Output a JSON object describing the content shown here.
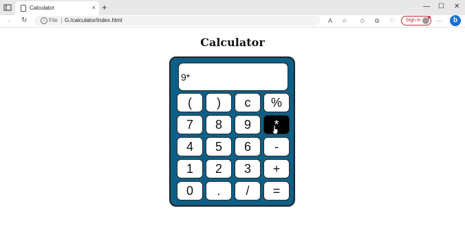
{
  "browser": {
    "tab_title": "Calculator",
    "tab_close": "×",
    "new_tab": "+",
    "file_label": "File",
    "url": "G:/calculator/index.html",
    "sign_in": "Sign in",
    "window_min": "—",
    "window_max": "☐",
    "window_close": "✕",
    "more": "···"
  },
  "page": {
    "title": "Calculator"
  },
  "calculator": {
    "display": "9*",
    "keys": [
      "(",
      ")",
      "c",
      "%",
      "7",
      "8",
      "9",
      "*",
      "4",
      "5",
      "6",
      "-",
      "1",
      "2",
      "3",
      "+",
      "0",
      ".",
      "/",
      "="
    ],
    "active_key": "*"
  },
  "colors": {
    "calc_body": "#0e5f86",
    "active_key": "#000000",
    "sign_in": "#c4262e"
  }
}
